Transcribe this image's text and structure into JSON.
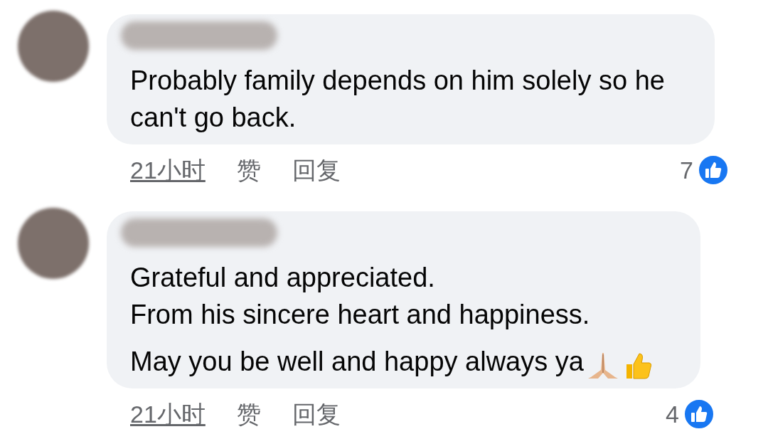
{
  "comments": [
    {
      "lines": [
        "Probably family depends on him solely so he",
        "can't go back."
      ],
      "emoji": false,
      "time": "21小时",
      "like": "赞",
      "reply": "回复",
      "reactions": "7"
    },
    {
      "lines": [
        "Grateful and appreciated.",
        "From his sincere heart and happiness.",
        "May you be well and happy always ya"
      ],
      "emoji": true,
      "time": "21小时",
      "like": "赞",
      "reply": "回复",
      "reactions": "4"
    }
  ]
}
